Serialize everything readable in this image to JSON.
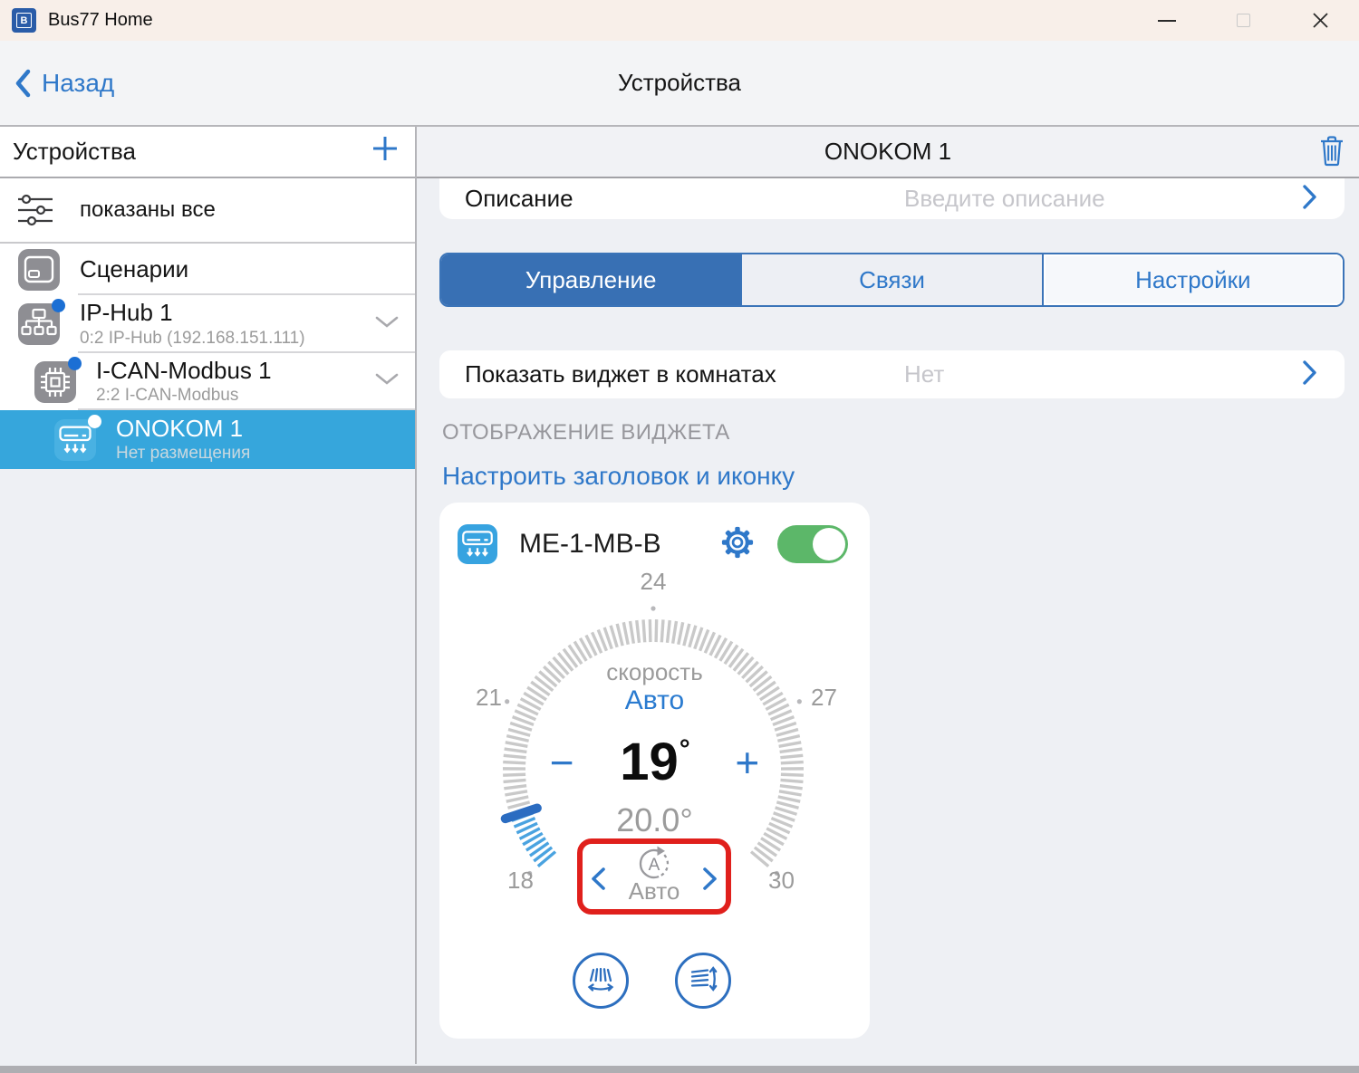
{
  "titlebar": {
    "app_title": "Bus77 Home"
  },
  "nav": {
    "back": "Назад",
    "title": "Устройства"
  },
  "sidebar": {
    "header": "Устройства",
    "filter": "показаны все",
    "items": [
      {
        "label": "Сценарии"
      },
      {
        "label": "IP-Hub 1",
        "subtitle": "0:2 IP-Hub (192.168.151.111)"
      },
      {
        "label": "I-CAN-Modbus 1",
        "subtitle": "2:2 I-CAN-Modbus"
      },
      {
        "label": "ONOKOM 1",
        "subtitle": "Нет размещения"
      }
    ]
  },
  "panel": {
    "title": "ONOKOM 1",
    "description": {
      "label": "Описание",
      "placeholder": "Введите описание"
    },
    "tabs": [
      {
        "label": "Управление",
        "active": true
      },
      {
        "label": "Связи",
        "active": false
      },
      {
        "label": "Настройки",
        "active": false
      }
    ],
    "rooms_row": {
      "label": "Показать виджет в комнатах",
      "value": "Нет"
    },
    "section": "ОТОБРАЖЕНИЕ ВИДЖЕТА",
    "configure_link": "Настроить заголовок и иконку"
  },
  "widget": {
    "title": "ME-1-MB-B",
    "toggle_on": true,
    "speed_label": "скорость",
    "speed_value": "Авто",
    "minus": "−",
    "setpoint": "19",
    "degree": "°",
    "plus": "+",
    "current": "20.0°",
    "mode_label": "Авто",
    "dial": {
      "min": 18,
      "max": 30,
      "value": 19,
      "current": 20.0,
      "labels": [
        18,
        21,
        24,
        27,
        30
      ],
      "start_angle": 220,
      "sweep": 260,
      "ticks": 104,
      "tick_color": "#c9c9c9",
      "active_color": "#4aa3e0",
      "handle_color": "#2b6cc1",
      "dot_color": "#b8b8bb"
    }
  },
  "colors": {
    "accent": "#2f78c9",
    "tab_active": "#3870b4",
    "selected_row": "#36a6dc",
    "toggle_on": "#5cb769",
    "annotation": "#e0201c",
    "titlebar": "#f8efe9"
  }
}
